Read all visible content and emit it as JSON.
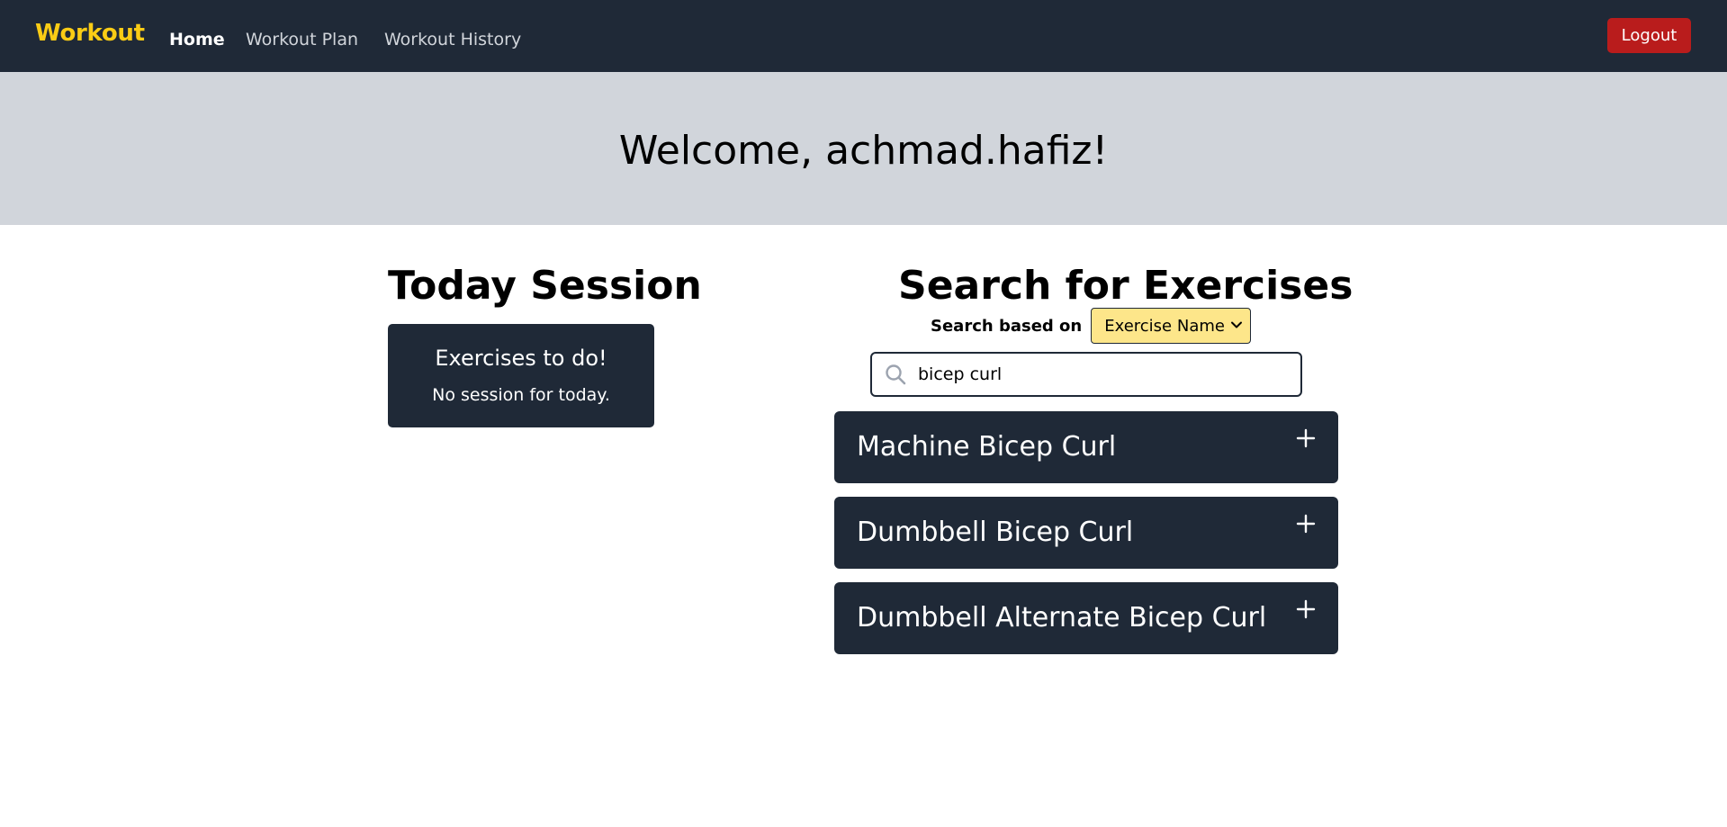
{
  "nav": {
    "brand": "Workout",
    "links": [
      "Home",
      "Workout Plan",
      "Workout History"
    ],
    "logout_label": "Logout"
  },
  "hero": {
    "title": "Welcome, achmad.hafiz!"
  },
  "today": {
    "title": "Today Session",
    "card_title": "Exercises to do!",
    "card_message": "No session for today."
  },
  "search": {
    "title": "Search for Exercises",
    "label": "Search based on",
    "selected_option": "Exercise Name",
    "query": "bicep curl"
  },
  "results": [
    {
      "name": "Machine Bicep Curl"
    },
    {
      "name": "Dumbbell Bicep Curl"
    },
    {
      "name": "Dumbbell Alternate Bicep Curl"
    }
  ],
  "colors": {
    "navbar": "#1f2937",
    "brand": "#facc15",
    "logout": "#b91c1c",
    "hero": "#d1d5db",
    "select": "#fde68a"
  }
}
